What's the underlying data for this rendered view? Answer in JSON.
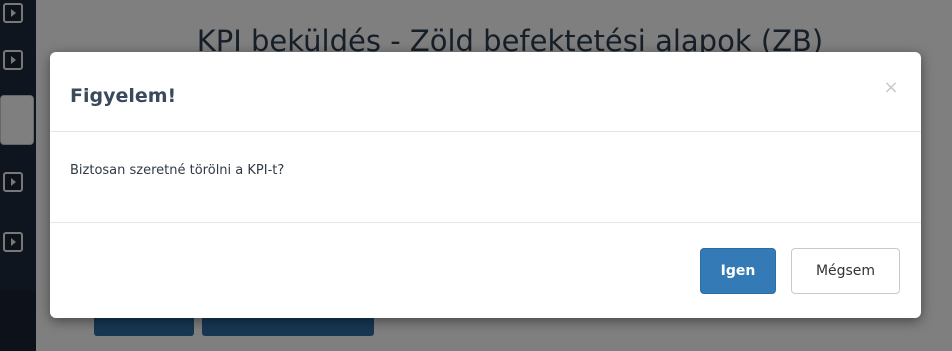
{
  "background": {
    "page_title": "KPI beküldés - Zöld befektetési alapok (ZB)"
  },
  "modal": {
    "title": "Figyelem!",
    "close_label": "×",
    "message": "Biztosan szeretné törölni a KPI-t?",
    "confirm_label": "Igen",
    "cancel_label": "Mégsem"
  },
  "colors": {
    "primary": "#337ab7",
    "backdrop": "rgba(0,0,0,0.5)",
    "sidebar": "#1d2a3d"
  },
  "icons": {
    "sidebar_buttons": "chevron-right-icon",
    "close": "close-icon"
  }
}
